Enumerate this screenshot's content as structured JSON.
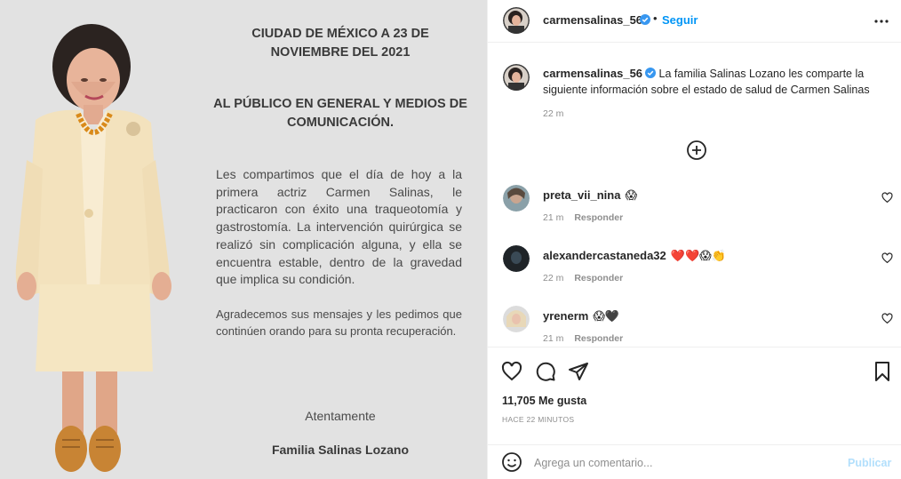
{
  "post_image": {
    "letter": {
      "date": "CIUDAD DE MÉXICO A 23 DE NOVIEMBRE DEL 2021",
      "heading": "AL PÚBLICO EN GENERAL Y MEDIOS DE COMUNICACIÓN.",
      "paragraph1": "Les compartimos que el día de hoy a la primera actriz Carmen Salinas, le practicaron con éxito una traqueotomía y gastrostomía. La intervención quirúrgica se realizó sin complicación alguna, y ella se encuentra estable, dentro de la gravedad que implica su condición.",
      "paragraph2": "Agradecemos sus mensajes y les pedimos que continúen orando para su pronta recuperación.",
      "closing": "Atentamente",
      "signature": "Familia Salinas Lozano"
    }
  },
  "header": {
    "username": "carmensalinas_56",
    "separator": "•",
    "follow_label": "Seguir",
    "more_icon": "more-horizontal-icon"
  },
  "caption": {
    "username": "carmensalinas_56",
    "text": "La familia Salinas Lozano les comparte la siguiente información sobre el estado de salud de Carmen Salinas",
    "time": "22 m"
  },
  "comments": [
    {
      "username": "preta_vii_nina",
      "emojis": "😱",
      "time": "21 m",
      "reply_label": "Responder"
    },
    {
      "username": "alexandercastaneda32",
      "emojis": "❤️❤️😱👏",
      "time": "22 m",
      "reply_label": "Responder"
    },
    {
      "username": "yrenerm",
      "emojis": "😱🖤",
      "time": "21 m",
      "reply_label": "Responder"
    }
  ],
  "actions": {
    "likes": "11,705 Me gusta",
    "posted": "HACE 22 MINUTOS"
  },
  "add_comment": {
    "placeholder": "Agrega un comentario...",
    "publish_label": "Publicar"
  },
  "colors": {
    "accent": "#0095f6",
    "publish_disabled": "#b2dffc",
    "image_background": "#e2e2e2",
    "muted_text": "#8e8e8e"
  }
}
